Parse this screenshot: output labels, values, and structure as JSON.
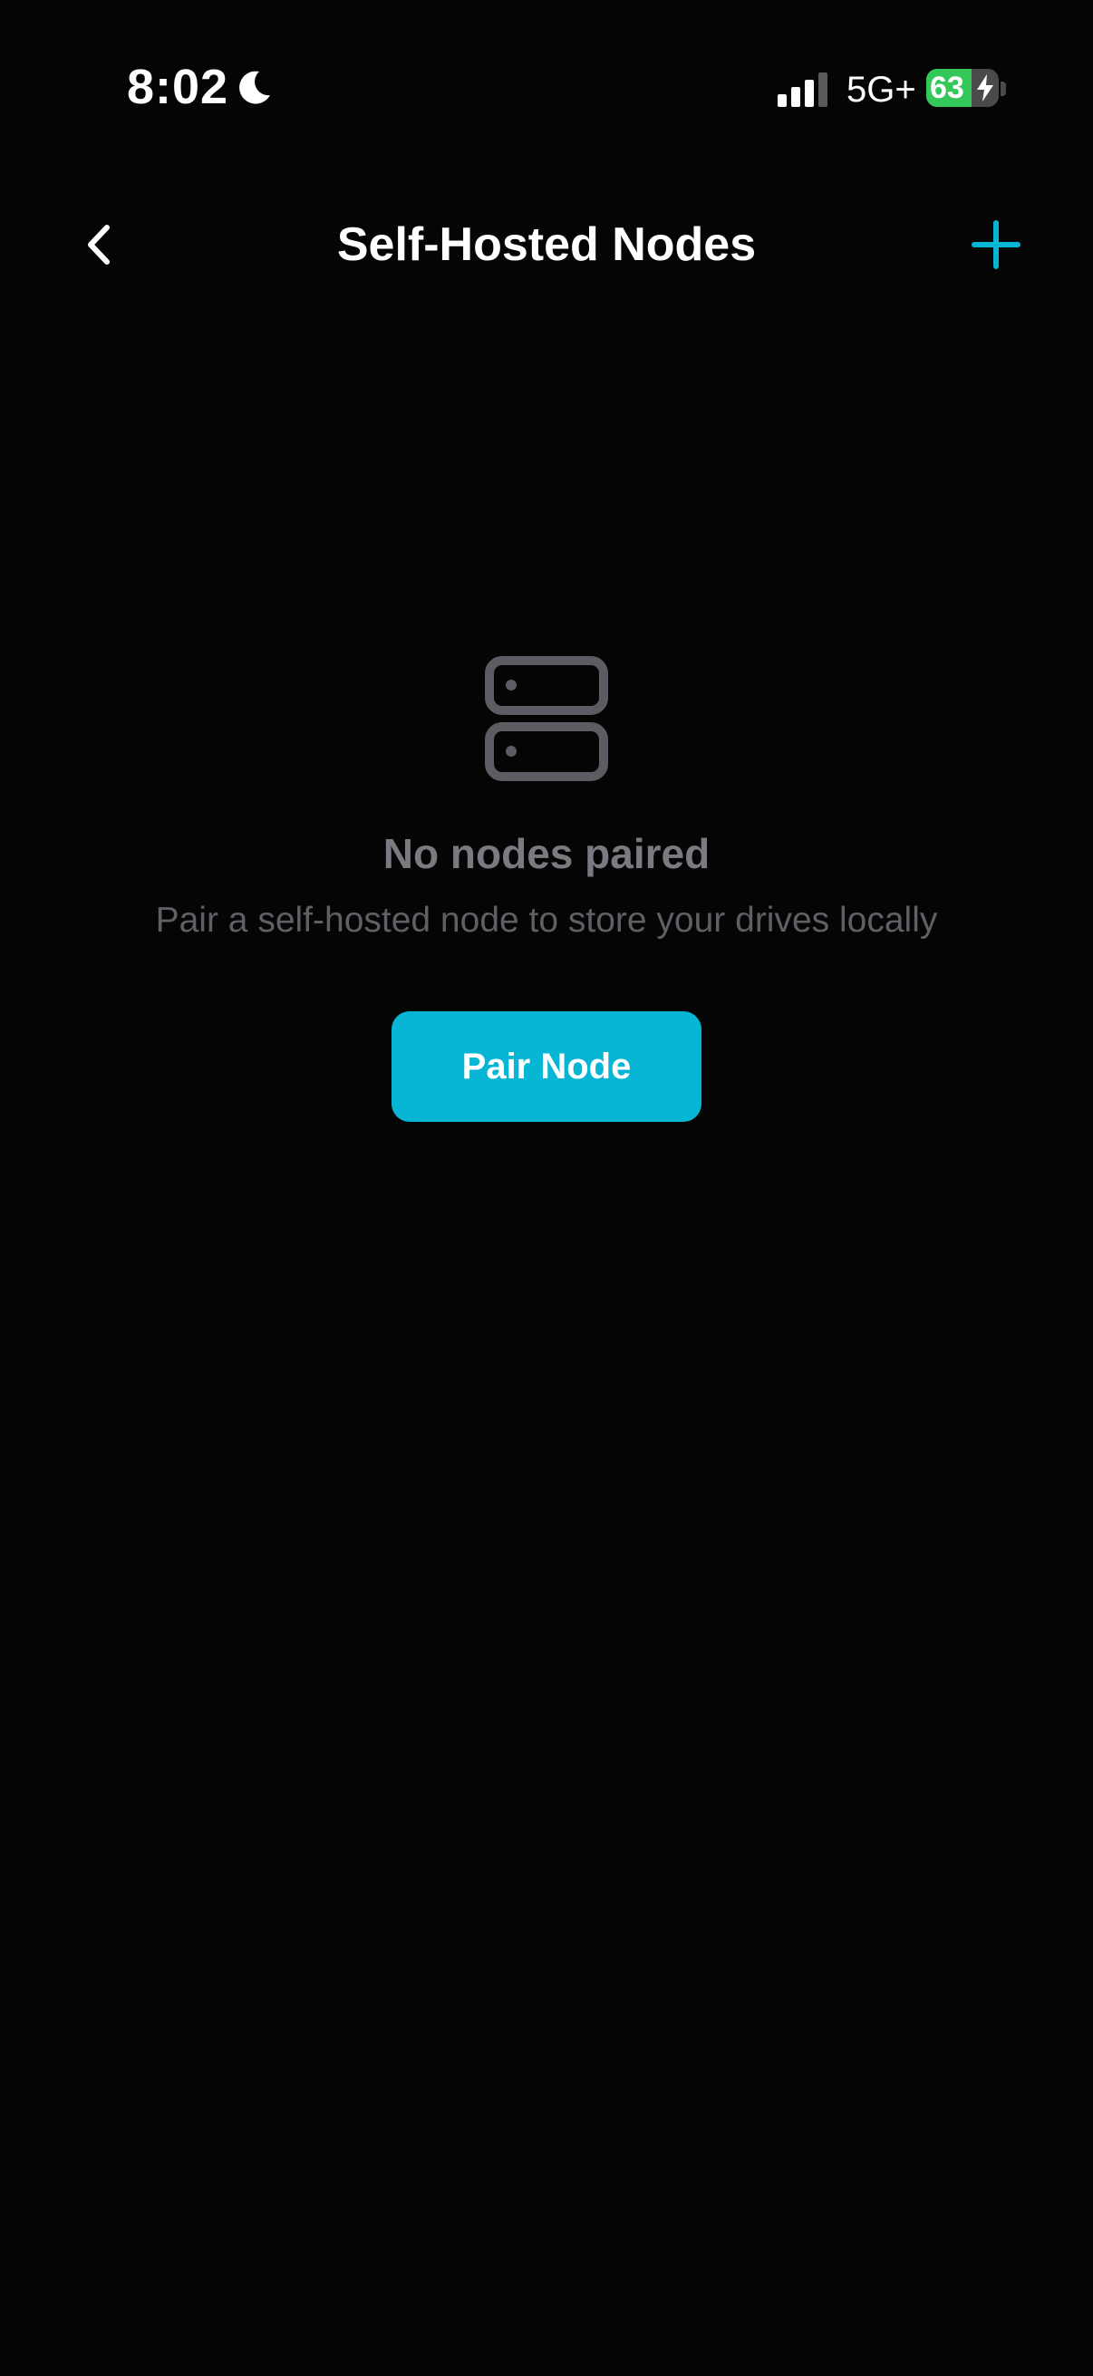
{
  "status_bar": {
    "time": "8:02",
    "network": "5G+",
    "battery_level": "63",
    "icons": [
      "moon-icon",
      "signal-icon",
      "battery-icon",
      "bolt-icon"
    ]
  },
  "nav": {
    "title": "Self-Hosted Nodes",
    "back_icon": "chevron-left-icon",
    "add_icon": "plus-icon"
  },
  "empty_state": {
    "icon": "server-icon",
    "title": "No nodes paired",
    "subtitle": "Pair a self-hosted node to store your drives locally",
    "button_label": "Pair Node"
  },
  "colors": {
    "background": "#050505",
    "accent": "#06b6d4",
    "battery_green": "#34c759",
    "muted_text": "#7a7a80",
    "subtle_text": "#5f5f65"
  }
}
